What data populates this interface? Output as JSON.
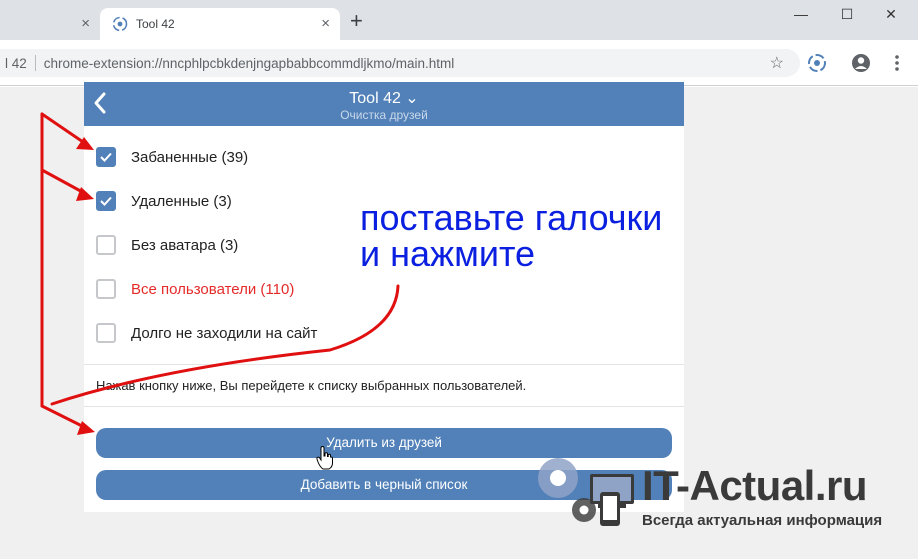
{
  "browser": {
    "inactive_tab_close": "×",
    "active_tab_title": "Tool 42",
    "active_tab_close": "×",
    "new_tab": "+",
    "window_controls": {
      "minimize": "—",
      "maximize": "☐",
      "close": "✕"
    },
    "omnibox_prefix": "l 42",
    "url": "chrome-extension://nncphlpcbkdenjngapbabbcommdljkmo/main.html",
    "star": "☆"
  },
  "header": {
    "title": "Tool 42 ⌄",
    "subtitle": "Очистка друзей"
  },
  "options": [
    {
      "label": "Забаненные (39)",
      "checked": true
    },
    {
      "label": "Удаленные (3)",
      "checked": true
    },
    {
      "label": "Без аватара (3)",
      "checked": false
    },
    {
      "label": "Все пользователи (110)",
      "checked": false,
      "color": "#e52a2a"
    },
    {
      "label": "Долго не заходили на сайт",
      "checked": false
    }
  ],
  "note": "Нажав кнопку ниже, Вы перейдете к списку выбранных пользователей.",
  "buttons": {
    "remove_friends": "Удалить из друзей",
    "add_blacklist": "Добавить в черный список"
  },
  "annotation": {
    "line1": "поставьте галочки",
    "line2": "и нажмите"
  },
  "watermark": {
    "name": "IT-Actual.ru",
    "tagline": "Всегда актуальная информация"
  },
  "colors": {
    "accent": "#5181b8",
    "annotation_text": "#0a1fe0",
    "arrow": "#e01010",
    "danger": "#e52a2a"
  }
}
